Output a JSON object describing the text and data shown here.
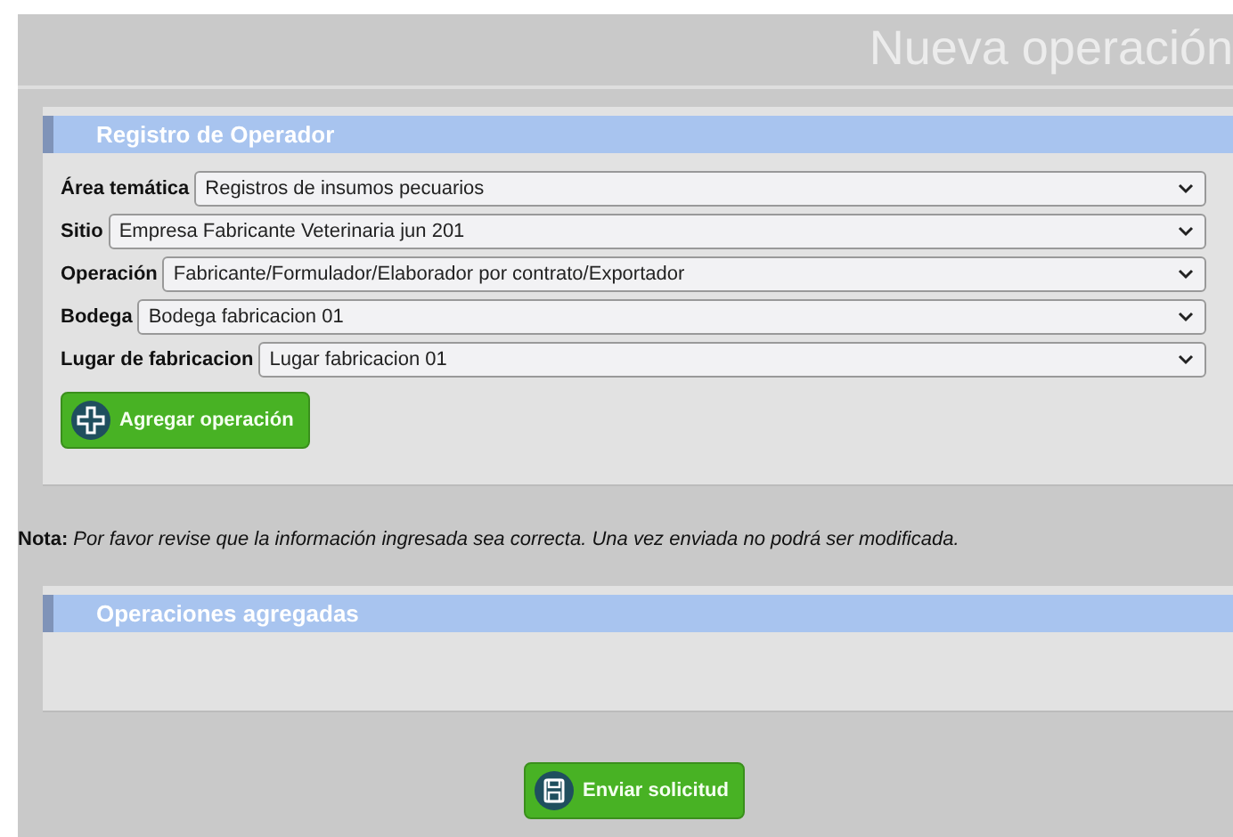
{
  "title": "Nueva operación",
  "operator_panel": {
    "heading": "Registro de Operador",
    "fields": [
      {
        "label": "Área temática",
        "value": "Registros de insumos pecuarios"
      },
      {
        "label": "Sitio",
        "value": "Empresa Fabricante Veterinaria jun 201"
      },
      {
        "label": "Operación",
        "value": "Fabricante/Formulador/Elaborador por contrato/Exportador"
      },
      {
        "label": "Bodega",
        "value": "Bodega fabricacion 01"
      },
      {
        "label": "Lugar de fabricacion",
        "value": "Lugar fabricacion 01"
      }
    ],
    "add_button": "Agregar operación"
  },
  "note": {
    "label": "Nota:",
    "text": "Por favor revise que la información ingresada sea correcta. Una vez enviada no podrá ser modificada."
  },
  "operations_panel": {
    "heading": "Operaciones agregadas"
  },
  "submit_button": "Enviar solicitud"
}
